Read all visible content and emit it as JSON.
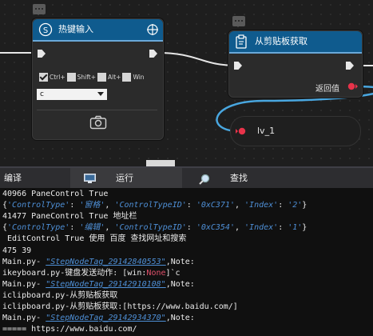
{
  "canvas": {
    "hotkey_node": {
      "title": "热键输入",
      "modifiers": [
        {
          "label": "Ctrl+",
          "checked": true
        },
        {
          "label": "Shift+",
          "checked": false
        },
        {
          "label": "Alt+",
          "checked": false
        },
        {
          "label": "Win",
          "checked": false
        }
      ],
      "key_value": "c"
    },
    "clipboard_node": {
      "title": "从剪贴板获取",
      "return_label": "返回值"
    },
    "variable_node": {
      "label": "lv_1"
    },
    "colors": {
      "header": "#0f5b8e",
      "wire": "#49a7e0",
      "pin_red": "#e8334a"
    }
  },
  "tabs": [
    {
      "label": "编译",
      "icon": ""
    },
    {
      "label": "运行",
      "icon": "monitor-icon"
    },
    {
      "label": "查找",
      "icon": "magnifier-icon"
    }
  ],
  "console": {
    "lines": [
      "40966 PaneControl True",
      "{'ControlType': '窗格', 'ControlTypeID': '0xC371', 'Index': '2'}",
      "41477 PaneControl True 地址栏",
      "{'ControlType': '编辑', 'ControlTypeID': '0xC354', 'Index': '1'}",
      " EditControl True 使用 百度 查找网址和搜索",
      "475 39",
      "Main.py- \"StepNodeTag_29142840553\",Note:",
      "ikeyboard.py-键盘发送动作: [win:None]`c",
      "Main.py- \"StepNodeTag_29142910108\",Note:",
      "iclipboard.py-从剪贴板获取",
      "iclipboard.py-从剪贴板获取:[https://www.baidu.com/]",
      "Main.py- \"StepNodeTag_29142934370\",Note:",
      "===== https://www.baidu.com/"
    ]
  }
}
